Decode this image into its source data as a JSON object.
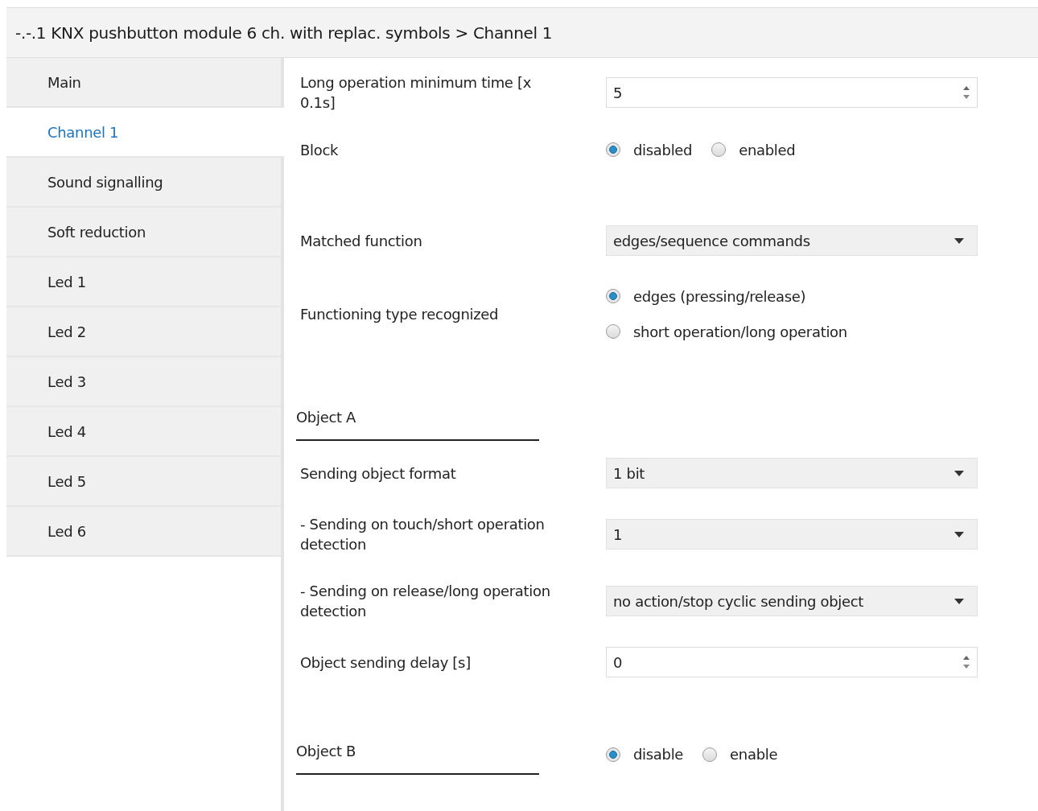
{
  "breadcrumb": "-.-.1 KNX pushbutton module 6 ch. with replac. symbols > Channel 1",
  "sidebar": {
    "items": [
      {
        "label": "Main",
        "selected": false
      },
      {
        "label": "Channel 1",
        "selected": true
      },
      {
        "label": "Sound signalling",
        "selected": false
      },
      {
        "label": "Soft reduction",
        "selected": false
      },
      {
        "label": "Led 1",
        "selected": false
      },
      {
        "label": "Led 2",
        "selected": false
      },
      {
        "label": "Led 3",
        "selected": false
      },
      {
        "label": "Led 4",
        "selected": false
      },
      {
        "label": "Led 5",
        "selected": false
      },
      {
        "label": "Led 6",
        "selected": false
      }
    ]
  },
  "parameters": [
    {
      "kind": "spin",
      "label": "Long operation minimum time [x 0.1s]",
      "value": "5"
    },
    {
      "kind": "radio",
      "label": "Block",
      "options": [
        {
          "label": "disabled",
          "selected": true
        },
        {
          "label": "enabled",
          "selected": false
        }
      ]
    },
    {
      "kind": "dropdown",
      "label": "Matched function",
      "value": "edges/sequence commands"
    },
    {
      "kind": "radio_stack",
      "label": "Functioning type recognized",
      "options": [
        {
          "label": "edges (pressing/release)",
          "selected": true
        },
        {
          "label": "short operation/long operation",
          "selected": false
        }
      ]
    },
    {
      "kind": "header",
      "label": "Object A"
    },
    {
      "kind": "dropdown",
      "label": "Sending object format",
      "value": "1 bit"
    },
    {
      "kind": "dropdown",
      "label": "- Sending on touch/short operation detection",
      "value": "1"
    },
    {
      "kind": "dropdown",
      "label": "- Sending on release/long operation detection",
      "value": "no action/stop cyclic sending object"
    },
    {
      "kind": "spin",
      "label": "Object sending delay [s]",
      "value": "0"
    },
    {
      "kind": "header",
      "label": "Object B",
      "options": [
        {
          "label": "disable",
          "selected": true
        },
        {
          "label": "enable",
          "selected": false
        }
      ]
    }
  ]
}
